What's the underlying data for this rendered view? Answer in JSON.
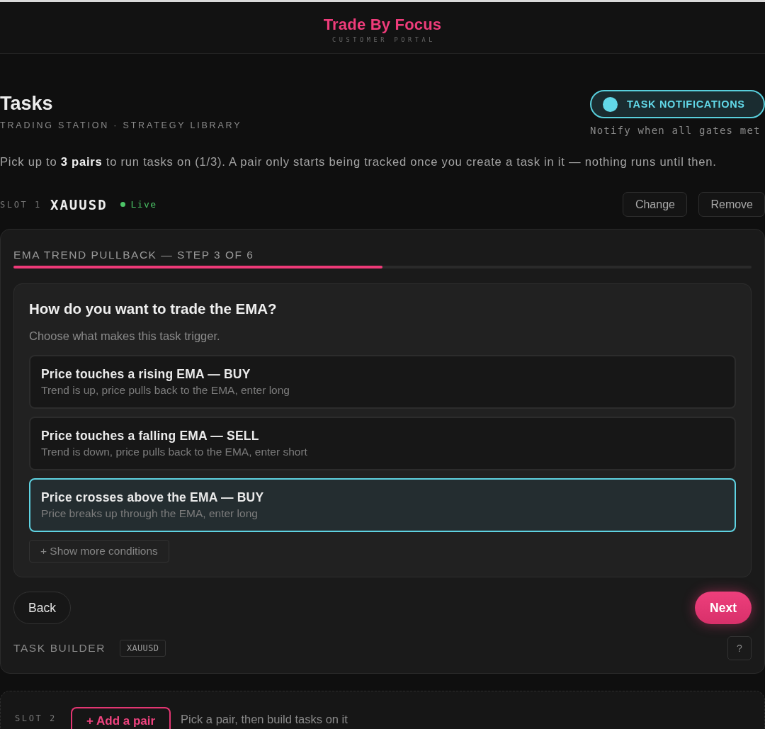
{
  "header": {
    "logo": "Trade By Focus",
    "tagline": "CUSTOMER PORTAL"
  },
  "page": {
    "title": "Tasks",
    "subtitle": "TRADING STATION · STRATEGY LIBRARY",
    "notifications": {
      "label": "TASK NOTIFICATIONS",
      "on": true,
      "hint": "Notify when all gates met"
    },
    "intro": "Pick up to **3 pairs** to run tasks on (1/3). A pair only starts being tracked once you create a task in it — nothing runs until then."
  },
  "slots": [
    {
      "kind": "filled",
      "label": "SLOT 1",
      "pair": "XAUUSD",
      "live": true,
      "status": "Live",
      "actions": [
        "Change",
        "Remove"
      ],
      "builder": {
        "step_label": "EMA TREND PULLBACK — STEP 3 OF 6",
        "progress": {
          "level": 0.5
        },
        "question": "How do you want to trade the EMA?",
        "hint": "Choose what makes this task trigger.",
        "options": [
          {
            "title": "Price touches a rising EMA — BUY",
            "description": "Trend is up, price pulls back to the EMA, enter long",
            "selected": false
          },
          {
            "title": "Price touches a falling EMA — SELL",
            "description": "Trend is down, price pulls back to the EMA, enter short",
            "selected": false
          },
          {
            "title": "Price crosses above the EMA — BUY",
            "description": "Price breaks up through the EMA, enter long",
            "selected": true
          }
        ],
        "more_button": "+ Show more conditions",
        "back_button": "Back",
        "next_button": "Next",
        "footer_label": "TASK BUILDER",
        "footer_chip": "XAUUSD",
        "help_button": "?"
      }
    },
    {
      "kind": "empty",
      "label": "SLOT 2",
      "add_button": "+ Add a pair",
      "hint": "Pick a pair, then build tasks on it"
    }
  ]
}
